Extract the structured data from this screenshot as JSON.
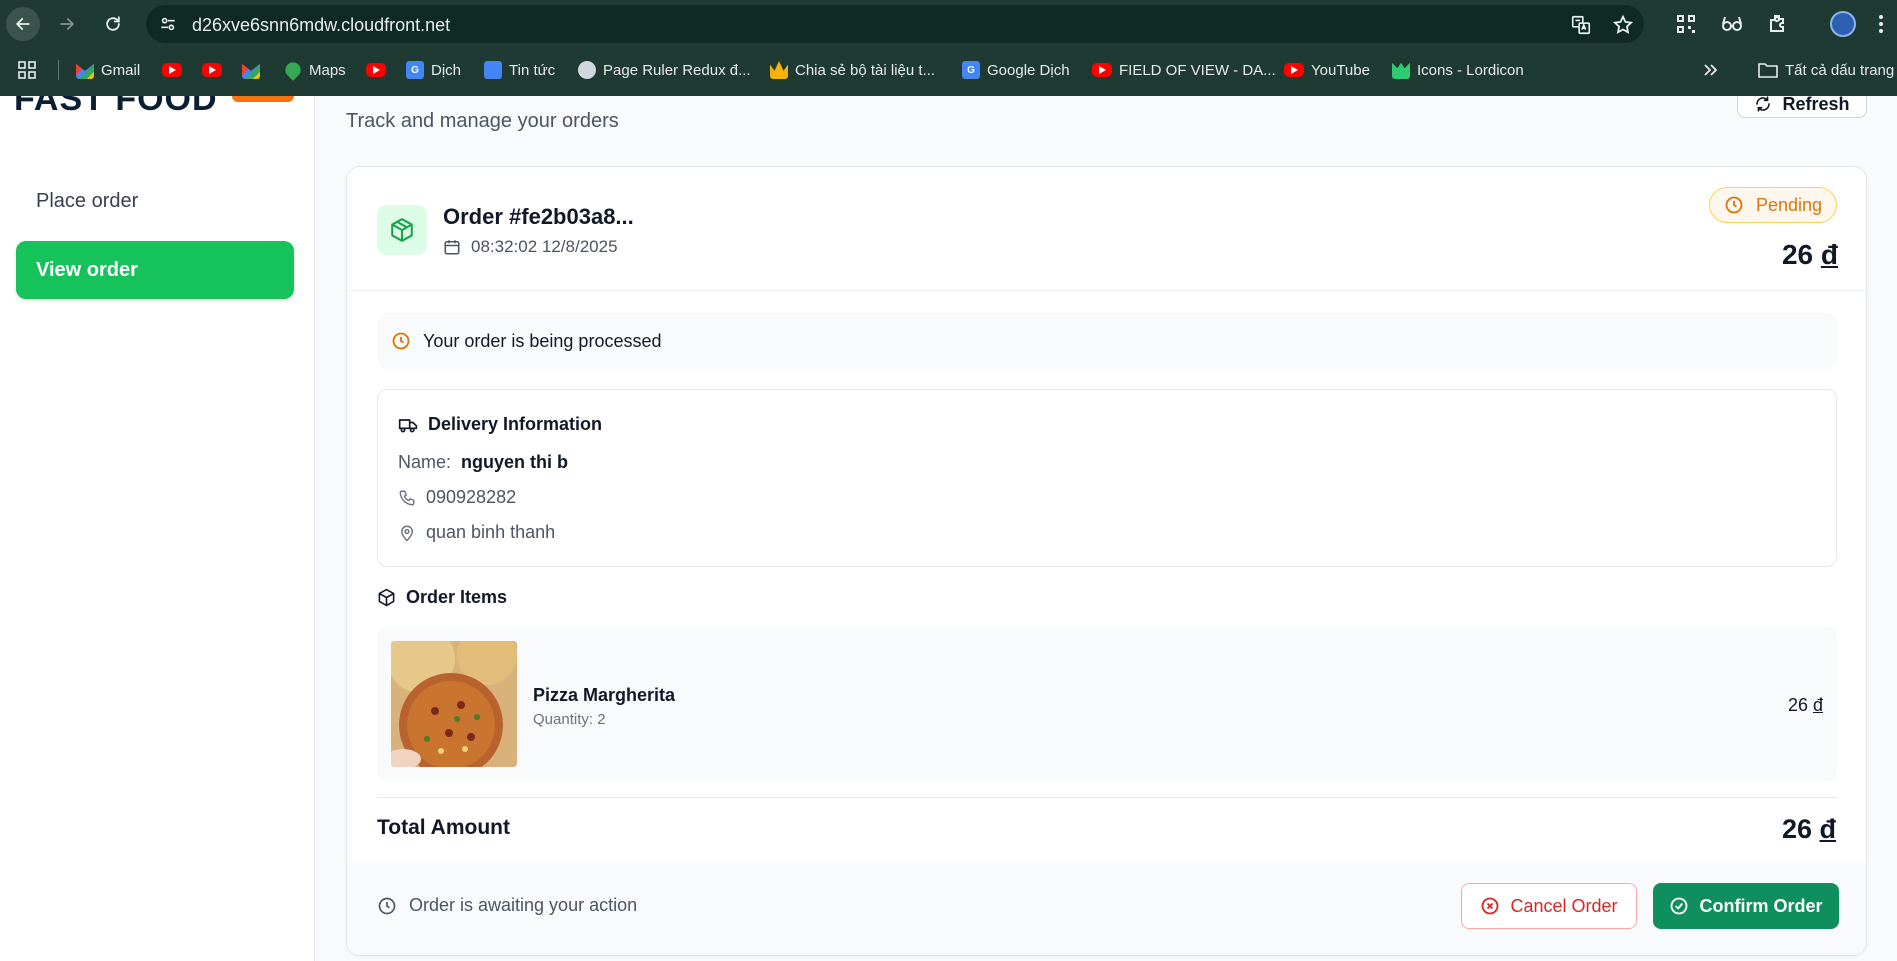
{
  "browser": {
    "url": "d26xve6snn6mdw.cloudfront.net",
    "bookmarks": [
      {
        "label": "Gmail",
        "icon": "gmail-icon"
      },
      {
        "label": "",
        "icon": "youtube-icon"
      },
      {
        "label": "",
        "icon": "youtube-icon"
      },
      {
        "label": "",
        "icon": "gmail-icon"
      },
      {
        "label": "Maps",
        "icon": "maps-icon"
      },
      {
        "label": "",
        "icon": "youtube-icon"
      },
      {
        "label": "Dịch",
        "icon": "google-translate-icon"
      },
      {
        "label": "Tin tức",
        "icon": "news-icon"
      },
      {
        "label": "Page Ruler Redux đ...",
        "icon": "globe-icon"
      },
      {
        "label": "Chia sẻ bộ tài liệu t...",
        "icon": "crown-icon"
      },
      {
        "label": "Google Dịch",
        "icon": "google-translate-icon"
      },
      {
        "label": "FIELD OF VIEW - DA...",
        "icon": "youtube-icon"
      },
      {
        "label": "YouTube",
        "icon": "youtube-icon"
      },
      {
        "label": "Icons - Lordicon",
        "icon": "lordicon-icon"
      }
    ],
    "all_bookmarks": "Tất cả dấu trang"
  },
  "sidebar": {
    "logo": "FAST FOOD",
    "items": [
      {
        "label": "Place order",
        "active": false
      },
      {
        "label": "View order",
        "active": true
      }
    ]
  },
  "header": {
    "subtitle": "Track and manage your orders",
    "refresh_label": "Refresh"
  },
  "order": {
    "title": "Order #fe2b03a8...",
    "datetime": "08:32:02 12/8/2025",
    "status": "Pending",
    "total": "26",
    "currency": "đ",
    "processing_message": "Your order is being processed",
    "delivery": {
      "title": "Delivery Information",
      "name_label": "Name:",
      "name": "nguyen thi b",
      "phone": "090928282",
      "address": "quan binh thanh"
    },
    "items_title": "Order Items",
    "items": [
      {
        "name": "Pizza Margherita",
        "quantity": "Quantity: 2",
        "price": "26"
      }
    ],
    "total_label": "Total Amount",
    "footer_message": "Order is awaiting your action",
    "cancel_label": "Cancel Order",
    "confirm_label": "Confirm Order"
  },
  "colors": {
    "accent_green": "#16c35a",
    "confirm_green": "#0f8f5e",
    "pending_orange": "#d97706",
    "cancel_red": "#dc2626",
    "chrome_bg": "#1f3a32"
  }
}
